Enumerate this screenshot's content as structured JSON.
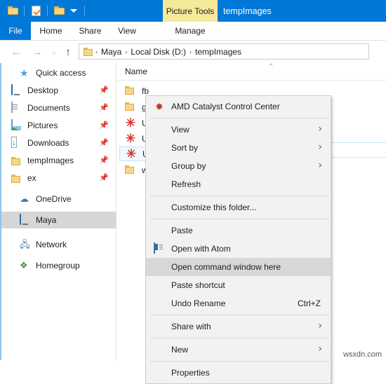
{
  "titlebar": {
    "quick_access_icons": [
      "folder-icon",
      "properties-check-icon",
      "new-folder-icon",
      "customize-qat-caret-icon"
    ],
    "contextual_tab": "Picture Tools",
    "window_title": "tempImages"
  },
  "ribbon": {
    "tabs": [
      {
        "label": "File",
        "name": "tab-file"
      },
      {
        "label": "Home",
        "name": "tab-home"
      },
      {
        "label": "Share",
        "name": "tab-share"
      },
      {
        "label": "View",
        "name": "tab-view"
      },
      {
        "label": "Manage",
        "name": "tab-manage"
      }
    ]
  },
  "navbar": {
    "back": "←",
    "forward": "→",
    "recent": "⌄",
    "up": "↑",
    "breadcrumbs": [
      "Maya",
      "Local Disk (D:)",
      "tempImages"
    ],
    "separator": "›"
  },
  "sidebar": {
    "items": [
      {
        "label": "Quick access",
        "icon": "star-icon",
        "pinned": false,
        "indent": 0,
        "selected": false
      },
      {
        "label": "Desktop",
        "icon": "monitor-icon",
        "pinned": true,
        "indent": 1,
        "selected": false
      },
      {
        "label": "Documents",
        "icon": "document-icon",
        "pinned": true,
        "indent": 1,
        "selected": false
      },
      {
        "label": "Pictures",
        "icon": "picture-icon",
        "pinned": true,
        "indent": 1,
        "selected": false
      },
      {
        "label": "Downloads",
        "icon": "download-icon",
        "pinned": true,
        "indent": 1,
        "selected": false
      },
      {
        "label": "tempImages",
        "icon": "folder-icon",
        "pinned": true,
        "indent": 1,
        "selected": false
      },
      {
        "label": "ex",
        "icon": "folder-icon",
        "pinned": true,
        "indent": 1,
        "selected": false
      },
      {
        "label": "OneDrive",
        "icon": "cloud-icon",
        "pinned": false,
        "indent": 0,
        "selected": false
      },
      {
        "label": "Maya",
        "icon": "monitor-icon",
        "pinned": false,
        "indent": 0,
        "selected": true
      },
      {
        "label": "Network",
        "icon": "network-icon",
        "pinned": false,
        "indent": 0,
        "selected": false
      },
      {
        "label": "Homegroup",
        "icon": "homegroup-icon",
        "pinned": false,
        "indent": 0,
        "selected": false
      }
    ],
    "pin_glyph": "📌"
  },
  "filelist": {
    "column_header": "Name",
    "sort_indicator": "⌃",
    "rows": [
      {
        "label": "fb",
        "icon": "folder-icon",
        "selected": false
      },
      {
        "label": "g",
        "icon": "folder-icon",
        "selected": false
      },
      {
        "label": "U",
        "icon": "image-file-icon",
        "selected": false
      },
      {
        "label": "U",
        "icon": "image-file-icon",
        "selected": false
      },
      {
        "label": "U",
        "icon": "image-file-icon",
        "selected": true
      },
      {
        "label": "w",
        "icon": "folder-icon",
        "selected": false
      }
    ],
    "asterisk_glyph": "✳"
  },
  "context_menu": {
    "items": [
      {
        "label": "AMD Catalyst Control Center",
        "icon": "amd-icon",
        "submenu": false,
        "accel": "",
        "highlight": false,
        "sep_after": true
      },
      {
        "label": "View",
        "icon": "",
        "submenu": true,
        "accel": "",
        "highlight": false,
        "sep_after": false
      },
      {
        "label": "Sort by",
        "icon": "",
        "submenu": true,
        "accel": "",
        "highlight": false,
        "sep_after": false
      },
      {
        "label": "Group by",
        "icon": "",
        "submenu": true,
        "accel": "",
        "highlight": false,
        "sep_after": false
      },
      {
        "label": "Refresh",
        "icon": "",
        "submenu": false,
        "accel": "",
        "highlight": false,
        "sep_after": true
      },
      {
        "label": "Customize this folder...",
        "icon": "",
        "submenu": false,
        "accel": "",
        "highlight": false,
        "sep_after": true
      },
      {
        "label": "Paste",
        "icon": "",
        "submenu": false,
        "accel": "",
        "highlight": false,
        "sep_after": false
      },
      {
        "label": "Open with Atom",
        "icon": "atom-icon",
        "submenu": false,
        "accel": "",
        "highlight": false,
        "sep_after": false
      },
      {
        "label": "Open command window here",
        "icon": "",
        "submenu": false,
        "accel": "",
        "highlight": true,
        "sep_after": false
      },
      {
        "label": "Paste shortcut",
        "icon": "",
        "submenu": false,
        "accel": "",
        "highlight": false,
        "sep_after": false
      },
      {
        "label": "Undo Rename",
        "icon": "",
        "submenu": false,
        "accel": "Ctrl+Z",
        "highlight": false,
        "sep_after": true
      },
      {
        "label": "Share with",
        "icon": "",
        "submenu": true,
        "accel": "",
        "highlight": false,
        "sep_after": true
      },
      {
        "label": "New",
        "icon": "",
        "submenu": true,
        "accel": "",
        "highlight": false,
        "sep_after": true
      },
      {
        "label": "Properties",
        "icon": "",
        "submenu": false,
        "accel": "",
        "highlight": false,
        "sep_after": false
      }
    ],
    "submenu_arrow": "›"
  },
  "watermark": {
    "text": "wsxdn.com"
  }
}
